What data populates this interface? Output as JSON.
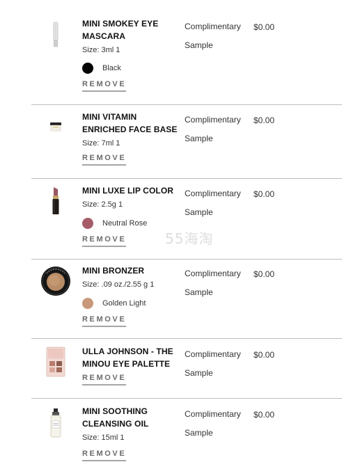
{
  "items": [
    {
      "name": "MINI SMOKEY EYE MASCARA",
      "size": "Size: 3ml 1",
      "shade": {
        "name": "Black",
        "color": "#050505"
      },
      "status": "Complimentary Sample",
      "status_line1": "Complimentary",
      "status_line2": "Sample",
      "price": "$0.00",
      "remove": "REMOVE",
      "image_icon": "mascara-icon"
    },
    {
      "name": "MINI VITAMIN ENRICHED FACE BASE",
      "size": "Size: 7ml 1",
      "status_line1": "Complimentary",
      "status_line2": "Sample",
      "price": "$0.00",
      "remove": "REMOVE",
      "image_icon": "face-base-jar-icon"
    },
    {
      "name": "MINI LUXE LIP COLOR",
      "size": "Size: 2.5g 1",
      "shade": {
        "name": "Neutral Rose",
        "color": "#a65c68"
      },
      "status_line1": "Complimentary",
      "status_line2": "Sample",
      "price": "$0.00",
      "remove": "REMOVE",
      "image_icon": "lipstick-icon"
    },
    {
      "name": "MINI BRONZER",
      "size": "Size: .09 oz./2.55 g 1",
      "shade": {
        "name": "Golden Light",
        "color": "#c8987a"
      },
      "status_line1": "Complimentary",
      "status_line2": "Sample",
      "price": "$0.00",
      "remove": "REMOVE",
      "image_icon": "bronzer-compact-icon"
    },
    {
      "name": "ULLA JOHNSON - THE MINOU EYE PALETTE",
      "status_line1": "Complimentary",
      "status_line2": "Sample",
      "price": "$0.00",
      "remove": "REMOVE",
      "image_icon": "eye-palette-icon"
    },
    {
      "name": "MINI SOOTHING CLEANSING OIL",
      "size": "Size: 15ml 1",
      "status_line1": "Complimentary",
      "status_line2": "Sample",
      "price": "$0.00",
      "remove": "REMOVE",
      "image_icon": "cleansing-oil-bottle-icon"
    }
  ],
  "watermark": "55海淘"
}
